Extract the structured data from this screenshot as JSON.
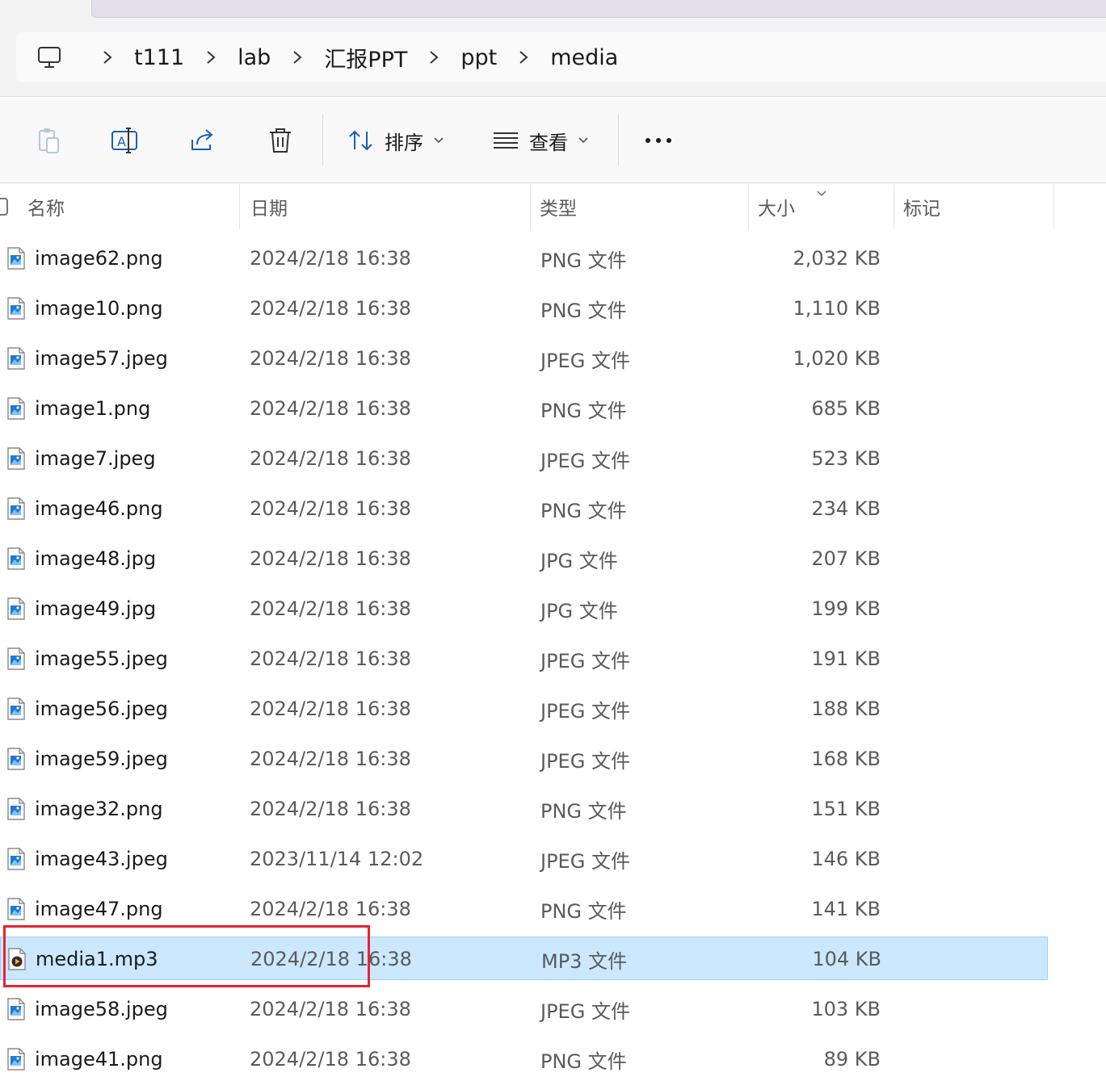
{
  "breadcrumb": [
    "t111",
    "lab",
    "汇报PPT",
    "ppt",
    "media"
  ],
  "toolbar": {
    "sort_label": "排序",
    "view_label": "查看"
  },
  "columns": {
    "name": "名称",
    "date": "日期",
    "type": "类型",
    "size": "大小",
    "tags": "标记"
  },
  "files": [
    {
      "name": "image62.png",
      "date": "2024/2/18 16:38",
      "type": "PNG 文件",
      "size": "2,032 KB",
      "icon": "image-file-icon"
    },
    {
      "name": "image10.png",
      "date": "2024/2/18 16:38",
      "type": "PNG 文件",
      "size": "1,110 KB",
      "icon": "image-file-icon"
    },
    {
      "name": "image57.jpeg",
      "date": "2024/2/18 16:38",
      "type": "JPEG 文件",
      "size": "1,020 KB",
      "icon": "image-file-icon"
    },
    {
      "name": "image1.png",
      "date": "2024/2/18 16:38",
      "type": "PNG 文件",
      "size": "685 KB",
      "icon": "image-file-icon"
    },
    {
      "name": "image7.jpeg",
      "date": "2024/2/18 16:38",
      "type": "JPEG 文件",
      "size": "523 KB",
      "icon": "image-file-icon"
    },
    {
      "name": "image46.png",
      "date": "2024/2/18 16:38",
      "type": "PNG 文件",
      "size": "234 KB",
      "icon": "image-file-icon"
    },
    {
      "name": "image48.jpg",
      "date": "2024/2/18 16:38",
      "type": "JPG 文件",
      "size": "207 KB",
      "icon": "image-file-icon"
    },
    {
      "name": "image49.jpg",
      "date": "2024/2/18 16:38",
      "type": "JPG 文件",
      "size": "199 KB",
      "icon": "image-file-icon"
    },
    {
      "name": "image55.jpeg",
      "date": "2024/2/18 16:38",
      "type": "JPEG 文件",
      "size": "191 KB",
      "icon": "image-file-icon"
    },
    {
      "name": "image56.jpeg",
      "date": "2024/2/18 16:38",
      "type": "JPEG 文件",
      "size": "188 KB",
      "icon": "image-file-icon"
    },
    {
      "name": "image59.jpeg",
      "date": "2024/2/18 16:38",
      "type": "JPEG 文件",
      "size": "168 KB",
      "icon": "image-file-icon"
    },
    {
      "name": "image32.png",
      "date": "2024/2/18 16:38",
      "type": "PNG 文件",
      "size": "151 KB",
      "icon": "image-file-icon"
    },
    {
      "name": "image43.jpeg",
      "date": "2023/11/14 12:02",
      "type": "JPEG 文件",
      "size": "146 KB",
      "icon": "image-file-icon"
    },
    {
      "name": "image47.png",
      "date": "2024/2/18 16:38",
      "type": "PNG 文件",
      "size": "141 KB",
      "icon": "image-file-icon"
    },
    {
      "name": "media1.mp3",
      "date": "2024/2/18 16:38",
      "type": "MP3 文件",
      "size": "104 KB",
      "icon": "audio-file-icon",
      "selected": true
    },
    {
      "name": "image58.jpeg",
      "date": "2024/2/18 16:38",
      "type": "JPEG 文件",
      "size": "103 KB",
      "icon": "image-file-icon"
    },
    {
      "name": "image41.png",
      "date": "2024/2/18 16:38",
      "type": "PNG 文件",
      "size": "89 KB",
      "icon": "image-file-icon"
    }
  ],
  "colors": {
    "selection_bg": "#cce8ff",
    "selection_border": "#99d1ff",
    "highlight_box": "#e5242f"
  }
}
